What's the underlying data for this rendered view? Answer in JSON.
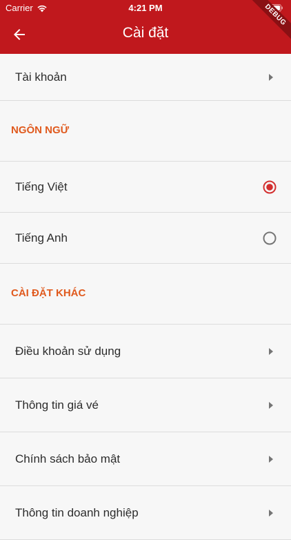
{
  "status_bar": {
    "carrier": "Carrier",
    "time": "4:21 PM"
  },
  "app_bar": {
    "title": "Cài đặt",
    "debug_label": "DEBUG",
    "color": "#c0181d"
  },
  "account": {
    "label": "Tài khoản"
  },
  "language_section": {
    "header": "NGÔN NGỮ",
    "options": [
      {
        "label": "Tiếng Việt",
        "selected": true
      },
      {
        "label": "Tiếng Anh",
        "selected": false
      }
    ]
  },
  "other_section": {
    "header": "CÀI ĐẶT KHÁC",
    "items": [
      {
        "label": "Điều khoản sử dụng"
      },
      {
        "label": "Thông tin giá vé"
      },
      {
        "label": "Chính sách bảo mật"
      },
      {
        "label": "Thông tin doanh nghiệp"
      }
    ]
  },
  "colors": {
    "section_header": "#e05a1e",
    "radio_selected": "#d32f2f",
    "radio_unselected": "#757575"
  }
}
